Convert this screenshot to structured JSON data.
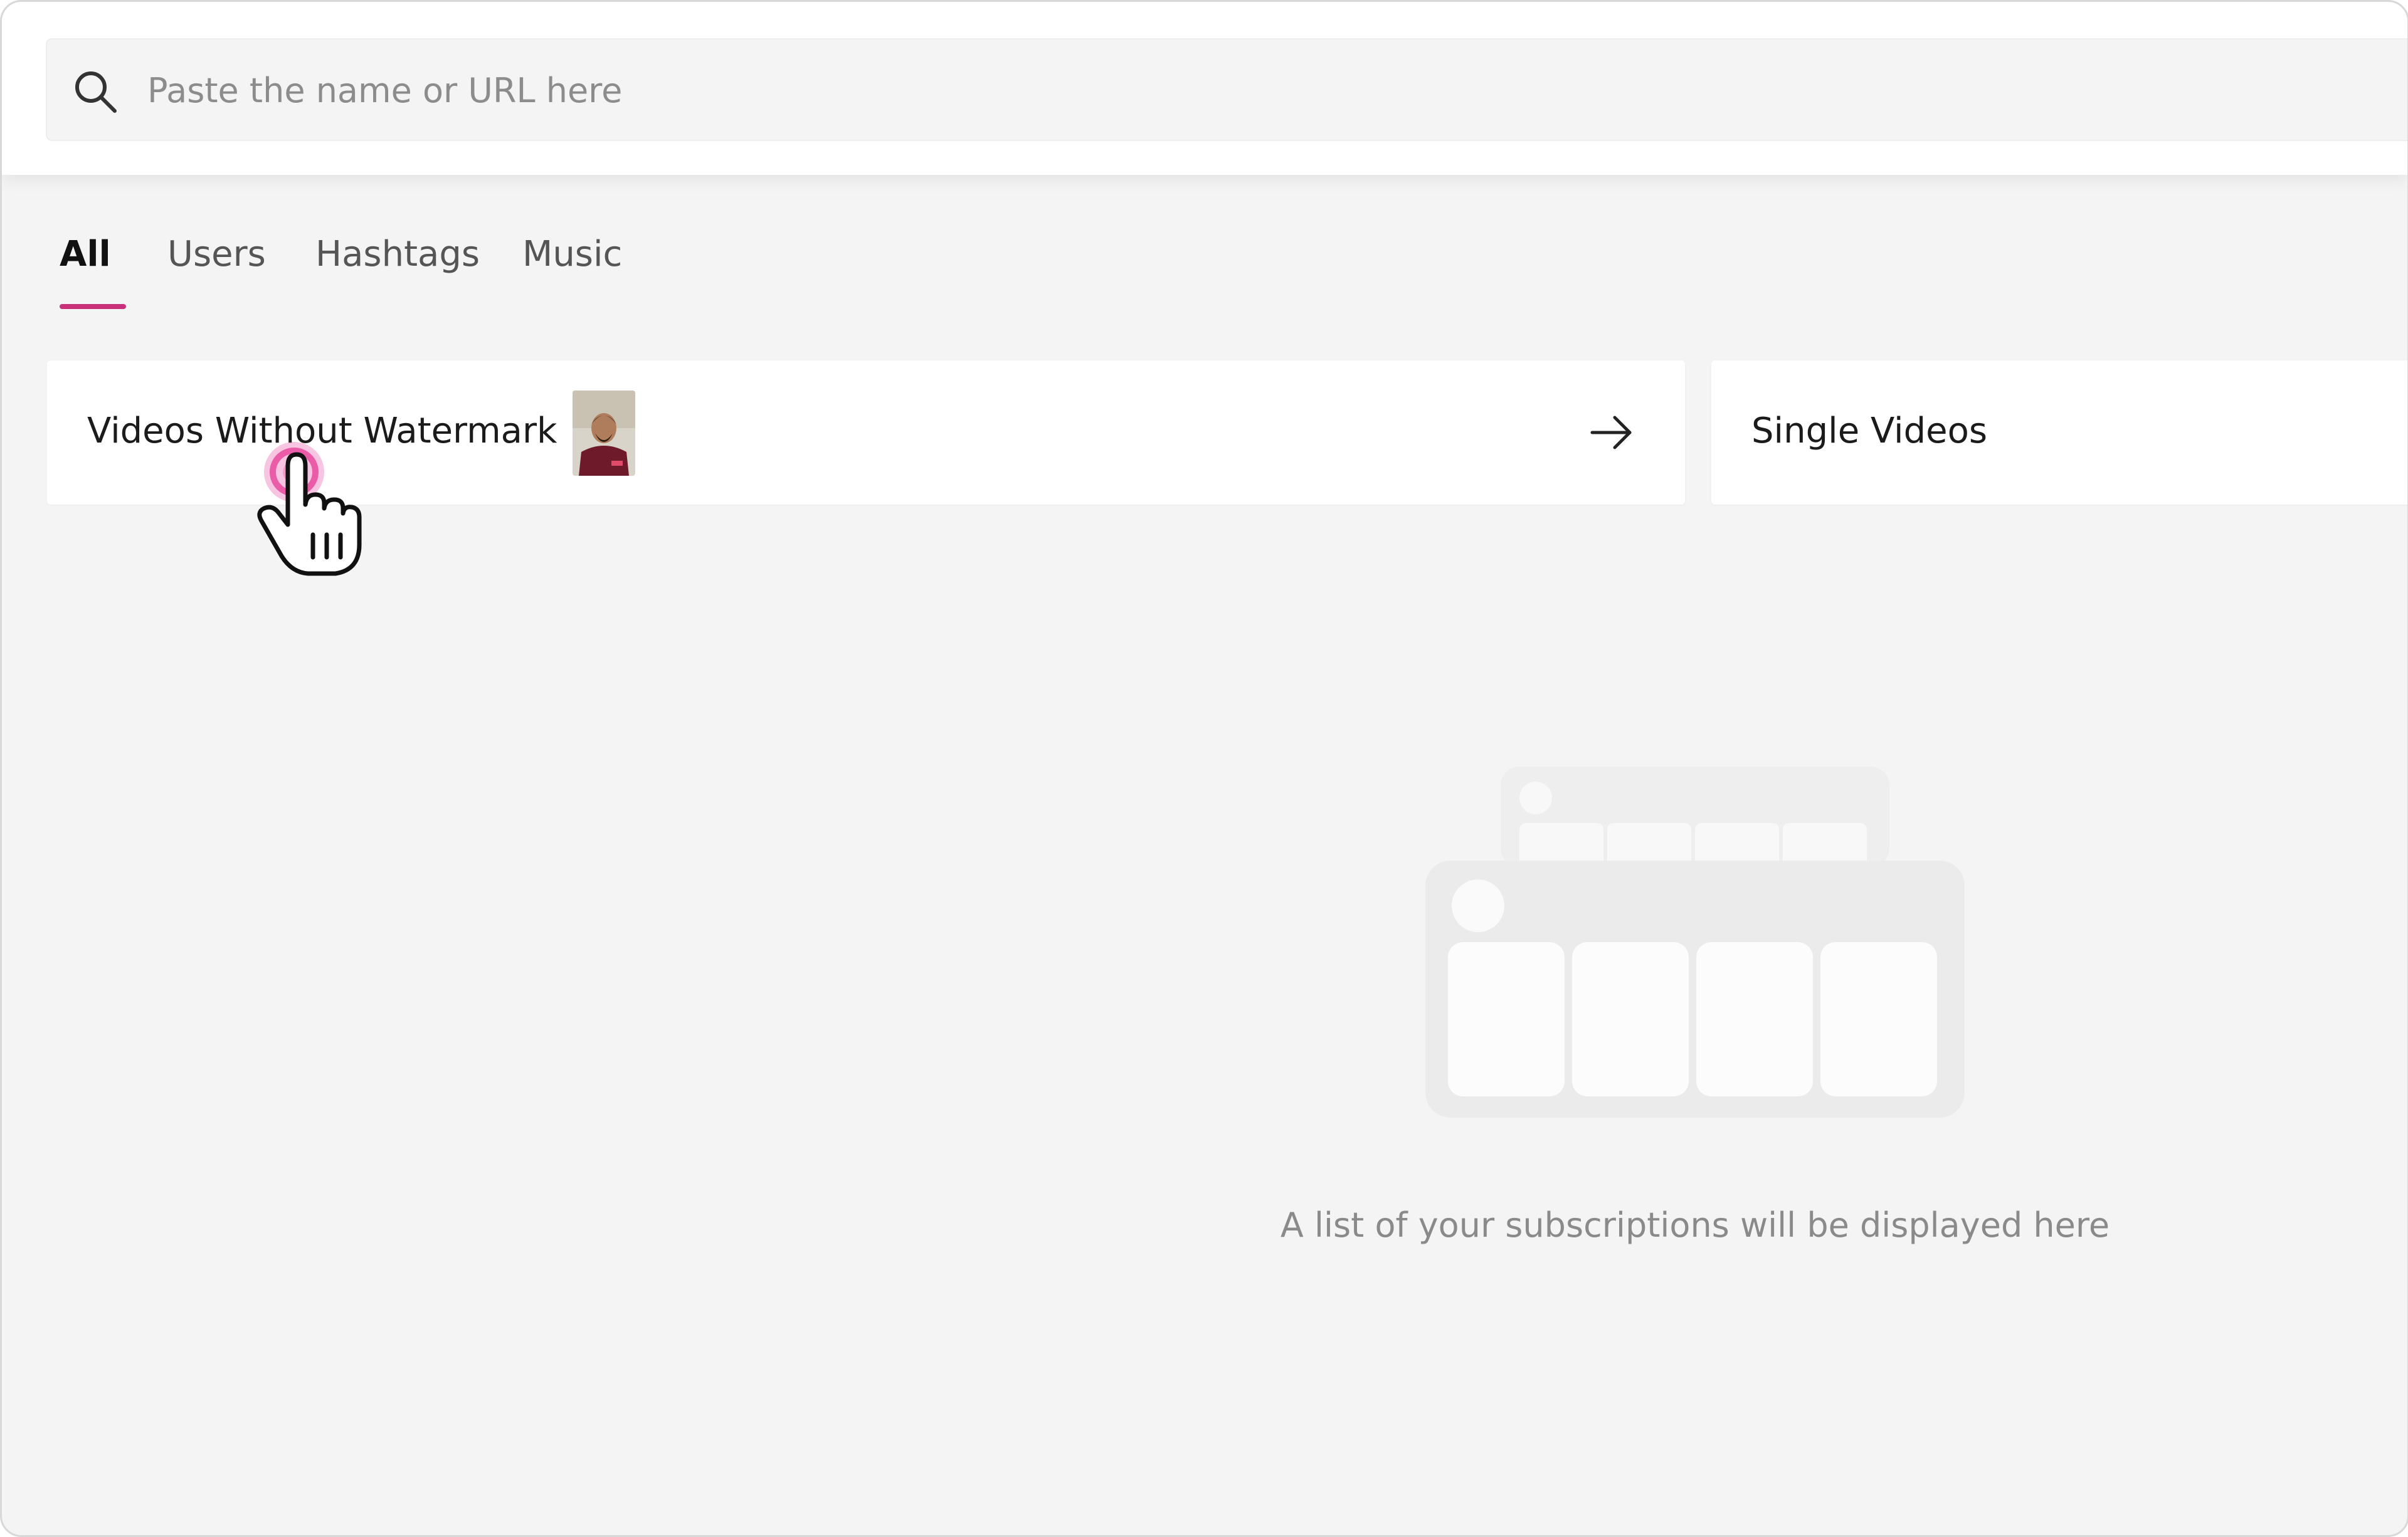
{
  "search": {
    "placeholder": "Paste the name or URL here",
    "icon": "search-icon"
  },
  "tabs": [
    {
      "label": "All",
      "active": true
    },
    {
      "label": "Users",
      "active": false
    },
    {
      "label": "Hashtags",
      "active": false
    },
    {
      "label": "Music",
      "active": false
    }
  ],
  "cards": [
    {
      "title": "Videos Without Watermark",
      "icon": "arrow-right-icon"
    },
    {
      "title": "Single Videos"
    }
  ],
  "empty_state": {
    "message": "A list of your subscriptions will be displayed here"
  },
  "colors": {
    "accent": "#c8307a",
    "background": "#f4f4f4",
    "card": "#ffffff"
  }
}
